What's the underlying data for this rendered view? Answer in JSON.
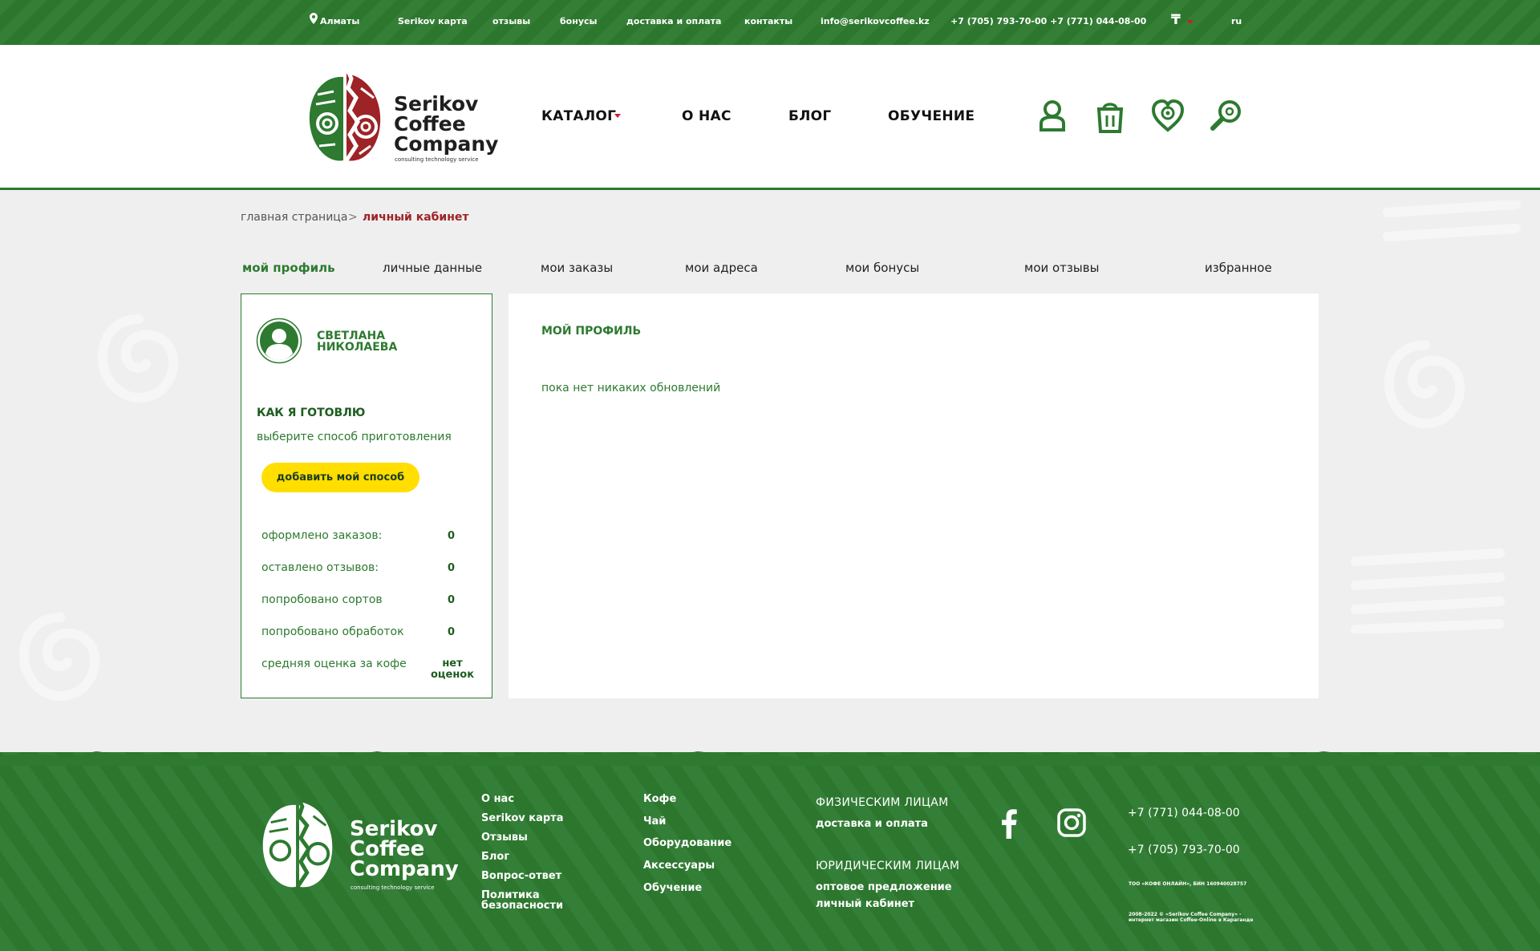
{
  "topbar": {
    "city": "Алматы",
    "links": [
      "Serikov карта",
      "отзывы",
      "бонусы",
      "доставка и оплата",
      "контакты"
    ],
    "email": "info@serikovcoffee.kz",
    "phones": "+7 (705) 793-70-00 +7 (771) 044-08-00",
    "currency": "₸",
    "lang": "ru"
  },
  "header": {
    "logo": {
      "line1": "Serikov",
      "line2": "Coffee",
      "line3": "Company",
      "tagline": "consulting technology service"
    },
    "nav": [
      "КАТАЛОГ",
      "О НАС",
      "БЛОГ",
      "ОБУЧЕНИЕ"
    ],
    "icons": [
      "account-icon",
      "cart-bag-icon",
      "favorites-heart-icon",
      "search-icon"
    ]
  },
  "breadcrumb": {
    "home": "главная страница",
    "separator": ">",
    "current": "личный кабинет"
  },
  "tabs": [
    "мой профиль",
    "личные данные",
    "мои заказы",
    "мои адреса",
    "мои бонусы",
    "мои отзывы",
    "избранное"
  ],
  "profile": {
    "first_name": "СВЕТЛАНА",
    "last_name": "НИКОЛАЕВА",
    "how_title": "КАК Я ГОТОВЛЮ",
    "how_subtitle": "выберите способ приготовления",
    "add_button": "добавить мой способ",
    "stats": [
      {
        "label": "оформлено заказов:",
        "value": "0"
      },
      {
        "label": "оставлено отзывов:",
        "value": "0"
      },
      {
        "label": "попробовано сортов",
        "value": "0"
      },
      {
        "label": "попробовано обработок",
        "value": "0"
      },
      {
        "label": "средняя оценка за кофе",
        "value_line1": "нет",
        "value_line2": "оценок"
      }
    ]
  },
  "main": {
    "title": "МОЙ ПРОФИЛЬ",
    "empty": "пока нет никаких обновлений"
  },
  "footer": {
    "logo": {
      "line1": "Serikov",
      "line2": "Coffee",
      "line3": "Company",
      "tagline": "consulting technology service"
    },
    "col1": [
      "О нас",
      "Serikov карта",
      "Отзывы",
      "Блог",
      "Вопрос-ответ"
    ],
    "policy_line1": "Политика",
    "policy_line2": "безопасности",
    "col2": [
      "Кофе",
      "Чай",
      "Оборудование",
      "Аксессуары",
      "Обучение"
    ],
    "individuals_title": "ФИЗИЧЕСКИМ ЛИЦАМ",
    "individuals_link": "доставка и оплата",
    "legal_title": "ЮРИДИЧЕСКИМ ЛИЦАМ",
    "legal_links": [
      "оптовое предложение",
      "личный кабинет"
    ],
    "phones": [
      "+7 (771) 044-08-00",
      "+7 (705) 793-70-00"
    ],
    "company_info": "ТОО «КОФЕ ОНЛАЙН», БИН 160940028757",
    "copyright_line1": "2008-2022 © «Serikov Coffee Company» -",
    "copyright_line2": "интернет магазин Coffee-Online в Караганде",
    "social": [
      "facebook-icon",
      "instagram-icon"
    ]
  },
  "colors": {
    "brand_green": "#2d7a30",
    "accent_red": "#c41f2b",
    "button_yellow": "#ffde00",
    "page_bg": "#efefef"
  }
}
